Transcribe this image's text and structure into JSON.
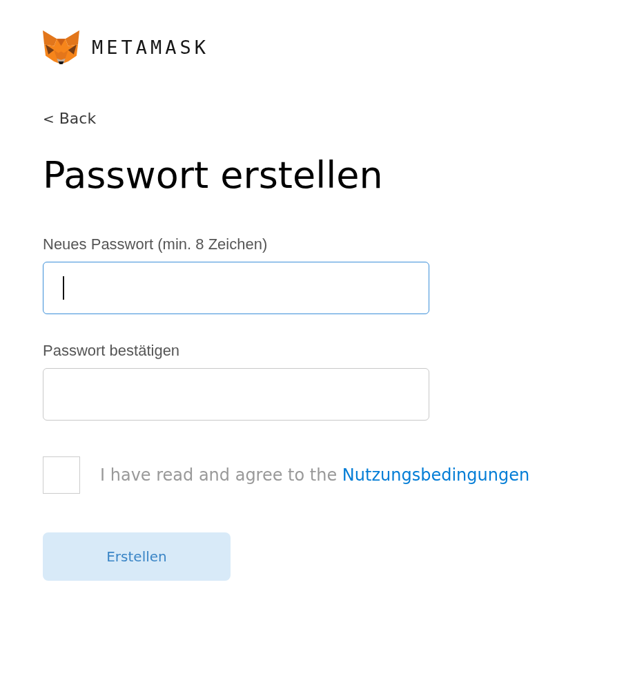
{
  "header": {
    "wordmark": "METAMASK"
  },
  "back_link": {
    "icon": "<",
    "label": "Back"
  },
  "title": "Passwort erstellen",
  "fields": [
    {
      "label": "Neues Passwort (min. 8 Zeichen)",
      "focused": true
    },
    {
      "label": "Passwort bestätigen",
      "focused": false
    }
  ],
  "terms": {
    "checked": false,
    "text": "I have read and agree to the",
    "link": "Nutzungsbedingungen"
  },
  "submit_button": {
    "label": "Erstellen",
    "disabled": true
  }
}
